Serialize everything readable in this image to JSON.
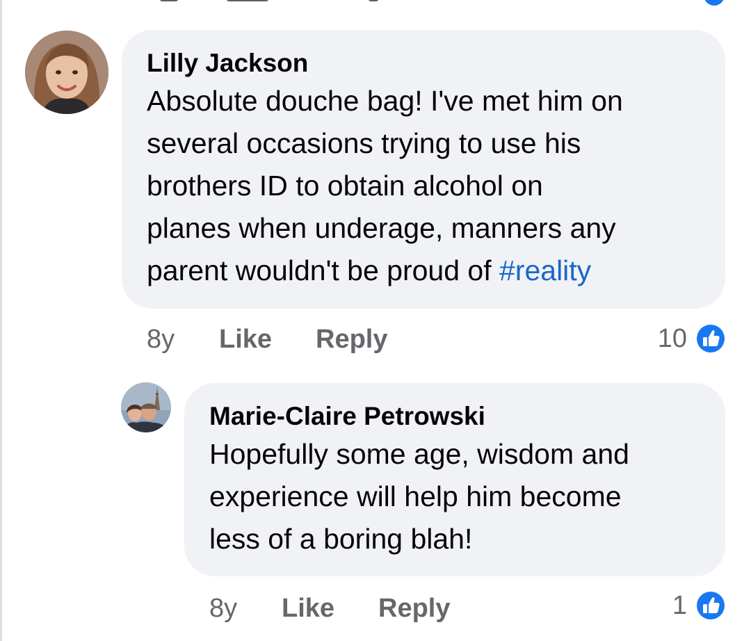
{
  "comments": [
    {
      "author": "Lilly Jackson",
      "lines": [
        "Absolute douche bag! I've met him on",
        "several occasions trying to use his",
        "brothers ID to obtain alcohol on",
        "planes when underage, manners any",
        "parent wouldn't be proud of "
      ],
      "hashtag": "#reality",
      "age": "8y",
      "like_label": "Like",
      "reply_label": "Reply",
      "reaction_count": "10"
    },
    {
      "author": "Marie-Claire Petrowski",
      "lines": [
        "Hopefully some age, wisdom and",
        "experience will help him become",
        "less of a boring blah!"
      ],
      "age": "8y",
      "like_label": "Like",
      "reply_label": "Reply",
      "reaction_count": "1"
    }
  ],
  "colors": {
    "bubble": "#f0f2f5",
    "text": "#050505",
    "meta": "#65676b",
    "hashtag": "#1b65c9",
    "like_badge": "#1877f2"
  },
  "icons": {
    "reaction": "like-thumbs-up-icon"
  }
}
